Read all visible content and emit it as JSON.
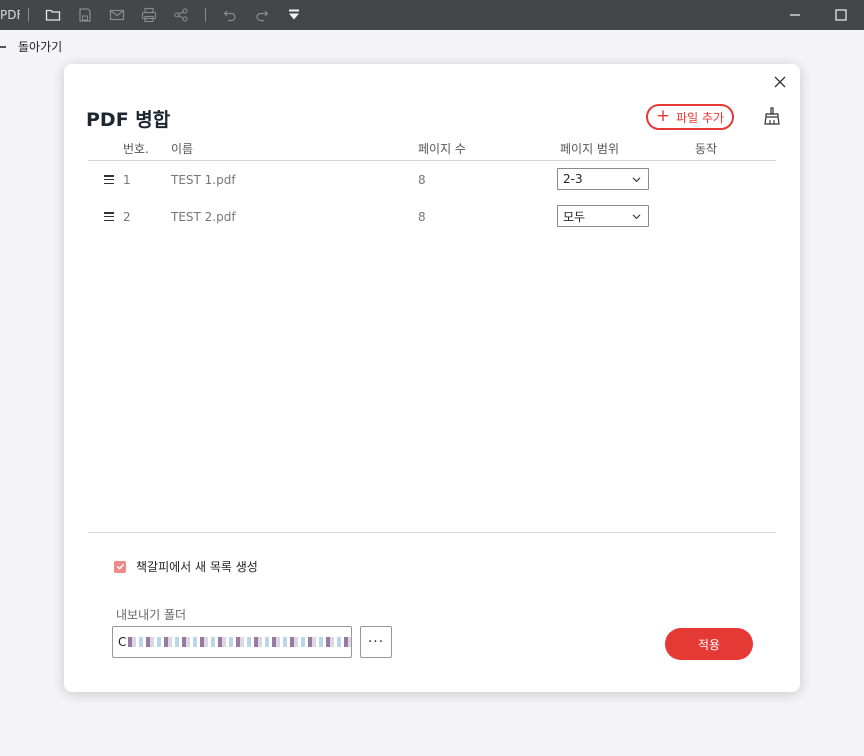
{
  "app": {
    "label": "PDF"
  },
  "toolbar": {
    "icons": [
      "open-folder-icon",
      "save-icon",
      "mail-icon",
      "print-icon",
      "share-icon",
      "undo-icon",
      "redo-icon",
      "dropdown-icon"
    ]
  },
  "back": {
    "label": "돌아가기"
  },
  "dialog": {
    "title": "PDF 병합",
    "add_file_label": "파일 추가",
    "columns": {
      "number": "번호.",
      "name": "이름",
      "pages": "페이지 수",
      "range": "페이지 범위",
      "action": "동작"
    },
    "rows": [
      {
        "number": "1",
        "name": "TEST 1.pdf",
        "pages": "8",
        "range": "2-3"
      },
      {
        "number": "2",
        "name": "TEST 2.pdf",
        "pages": "8",
        "range": "모두"
      }
    ],
    "bookmark_checkbox": {
      "label": "책갈피에서 새 목록 생성",
      "checked": true
    },
    "export_folder": {
      "label": "내보내기 폴더",
      "value": "C"
    },
    "browse_label": "···",
    "apply_label": "적용"
  },
  "colors": {
    "accent": "#e53935",
    "topbar": "#444649",
    "checkbox": "#f08a8a"
  }
}
